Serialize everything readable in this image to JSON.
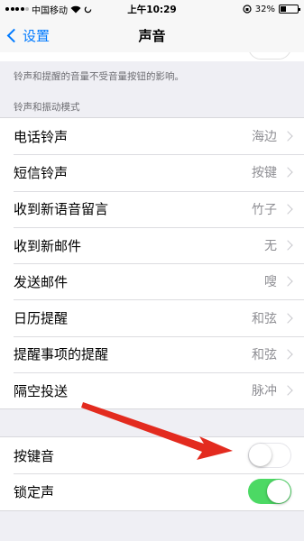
{
  "status_bar": {
    "carrier": "中国移动",
    "time": "上午10:29",
    "battery": "32%",
    "battery_level": 0.32
  },
  "nav": {
    "back_label": "设置",
    "title": "声音"
  },
  "footnote": "铃声和提醒的音量不受音量按钮的影响。",
  "section_header": "铃声和振动模式",
  "sound_rows": [
    {
      "label": "电话铃声",
      "value": "海边"
    },
    {
      "label": "短信铃声",
      "value": "按键"
    },
    {
      "label": "收到新语音留言",
      "value": "竹子"
    },
    {
      "label": "收到新邮件",
      "value": "无"
    },
    {
      "label": "发送邮件",
      "value": "嗖"
    },
    {
      "label": "日历提醒",
      "value": "和弦"
    },
    {
      "label": "提醒事项的提醒",
      "value": "和弦"
    },
    {
      "label": "隔空投送",
      "value": "脉冲"
    }
  ],
  "toggle_rows": [
    {
      "label": "按键音",
      "on": false
    },
    {
      "label": "锁定声",
      "on": true
    }
  ],
  "colors": {
    "accent": "#007aff",
    "toggle_on": "#4cd964",
    "annotation_arrow": "#e32b1f"
  }
}
